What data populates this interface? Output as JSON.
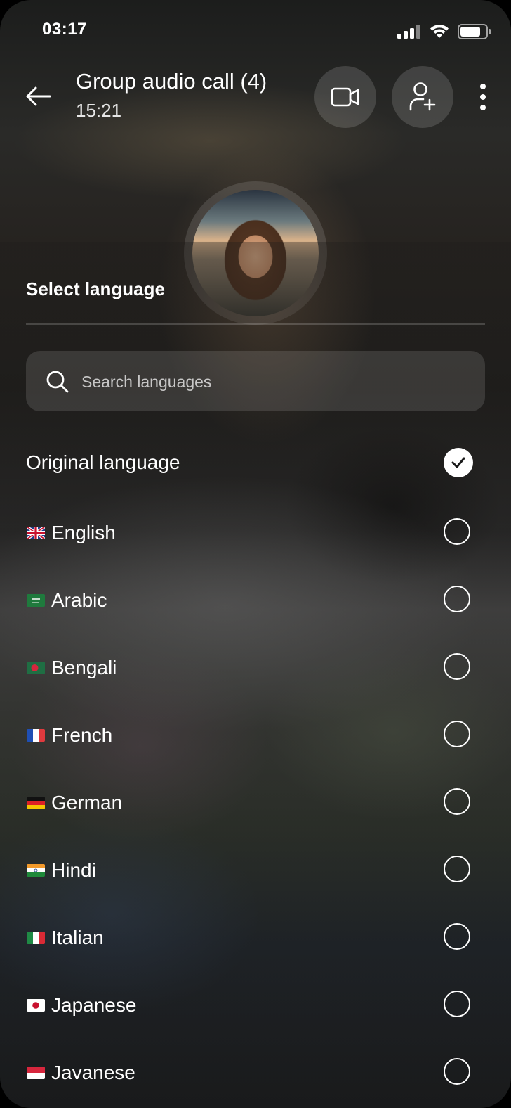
{
  "status_bar": {
    "time": "03:17",
    "icons": [
      "signal-icon",
      "wifi-icon",
      "battery-icon"
    ]
  },
  "header": {
    "title": "Group audio call (4)",
    "timer": "15:21",
    "buttons": [
      "back-arrow-icon",
      "video-camera-icon",
      "add-person-icon",
      "more-vertical-icon"
    ]
  },
  "sheet": {
    "title": "Select language",
    "search": {
      "placeholder": "Search languages",
      "value": ""
    },
    "original": {
      "label": "Original language",
      "selected": true
    },
    "languages": [
      {
        "label": "English",
        "flag": "flag-uk-icon",
        "selected": false
      },
      {
        "label": "Arabic",
        "flag": "flag-saudi-arabia-icon",
        "selected": false
      },
      {
        "label": "Bengali",
        "flag": "flag-bangladesh-icon",
        "selected": false
      },
      {
        "label": "French",
        "flag": "flag-france-icon",
        "selected": false
      },
      {
        "label": "German",
        "flag": "flag-germany-icon",
        "selected": false
      },
      {
        "label": "Hindi",
        "flag": "flag-india-icon",
        "selected": false
      },
      {
        "label": "Italian",
        "flag": "flag-italy-icon",
        "selected": false
      },
      {
        "label": "Japanese",
        "flag": "flag-japan-icon",
        "selected": false
      },
      {
        "label": "Javanese",
        "flag": "flag-indonesia-icon",
        "selected": false
      }
    ]
  },
  "colors": {
    "text": "#ffffff",
    "check_fill": "#ffffff",
    "check_mark": "#1a1a1a"
  }
}
